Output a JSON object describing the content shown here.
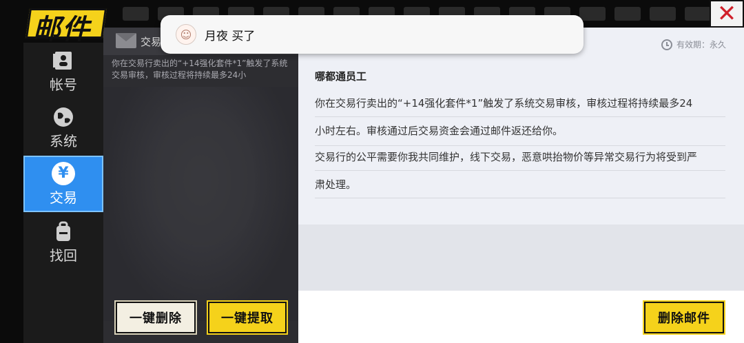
{
  "header": {
    "title": "邮件",
    "close_icon": "close-icon"
  },
  "sidebar": {
    "items": [
      {
        "label": "帐号",
        "icon": "id-card-icon"
      },
      {
        "label": "系统",
        "icon": "globe-icon"
      },
      {
        "label": "交易",
        "icon": "yen-icon",
        "active": true
      },
      {
        "label": "找回",
        "icon": "backpack-icon"
      }
    ]
  },
  "mail_list": {
    "selected": {
      "sender": "交易",
      "preview": "你在交易行卖出的“+14强化套件*1”触发了系统交易审核，审核过程将持续最多24小"
    },
    "buttons": {
      "delete_all": "一键删除",
      "claim_all": "一键提取"
    }
  },
  "mail_detail": {
    "validity": "有效期：永久",
    "sender": "哪都通员工",
    "lines": [
      "你在交易行卖出的“+14强化套件*1”触发了系统交易审核，审核过程将持续最多24",
      "小时左右。审核通过后交易资金会通过邮件返还给你。",
      "交易行的公平需要你我共同维护，线下交易，恶意哄抬物价等异常交易行为将受到严",
      "肃处理。"
    ],
    "delete_button": "删除邮件"
  },
  "notification": {
    "text": "月夜 买了"
  },
  "colors": {
    "accent_yellow": "#f5d21b",
    "active_blue": "#2f8ff0",
    "close_red": "#d0202a"
  }
}
